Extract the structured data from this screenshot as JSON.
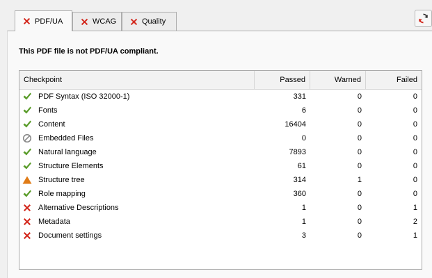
{
  "tabs": [
    {
      "label": "PDF/UA",
      "status_icon": "fail-x-icon",
      "active": true
    },
    {
      "label": "WCAG",
      "status_icon": "fail-x-icon",
      "active": false
    },
    {
      "label": "Quality",
      "status_icon": "fail-x-icon",
      "active": false
    }
  ],
  "refresh_button": {
    "icon": "refresh-icon"
  },
  "status_message": "This PDF file is not PDF/UA compliant.",
  "table": {
    "headers": [
      "Checkpoint",
      "Passed",
      "Warned",
      "Failed"
    ],
    "rows": [
      {
        "icon": "check",
        "name": "PDF Syntax (ISO 32000-1)",
        "passed": "331",
        "warned": "0",
        "failed": "0"
      },
      {
        "icon": "check",
        "name": "Fonts",
        "passed": "6",
        "warned": "0",
        "failed": "0"
      },
      {
        "icon": "check",
        "name": "Content",
        "passed": "16404",
        "warned": "0",
        "failed": "0"
      },
      {
        "icon": "na",
        "name": "Embedded Files",
        "passed": "0",
        "warned": "0",
        "failed": "0"
      },
      {
        "icon": "check",
        "name": "Natural language",
        "passed": "7893",
        "warned": "0",
        "failed": "0"
      },
      {
        "icon": "check",
        "name": "Structure Elements",
        "passed": "61",
        "warned": "0",
        "failed": "0"
      },
      {
        "icon": "warn",
        "name": "Structure tree",
        "passed": "314",
        "warned": "1",
        "failed": "0"
      },
      {
        "icon": "check",
        "name": "Role mapping",
        "passed": "360",
        "warned": "0",
        "failed": "0"
      },
      {
        "icon": "fail",
        "name": "Alternative Descriptions",
        "passed": "1",
        "warned": "0",
        "failed": "1"
      },
      {
        "icon": "fail",
        "name": "Metadata",
        "passed": "1",
        "warned": "0",
        "failed": "2"
      },
      {
        "icon": "fail",
        "name": "Document settings",
        "passed": "3",
        "warned": "0",
        "failed": "1"
      }
    ]
  },
  "colors": {
    "check": "#5a9c2a",
    "fail": "#d3281d",
    "warn": "#e07b16",
    "na": "#8a8a8a"
  }
}
